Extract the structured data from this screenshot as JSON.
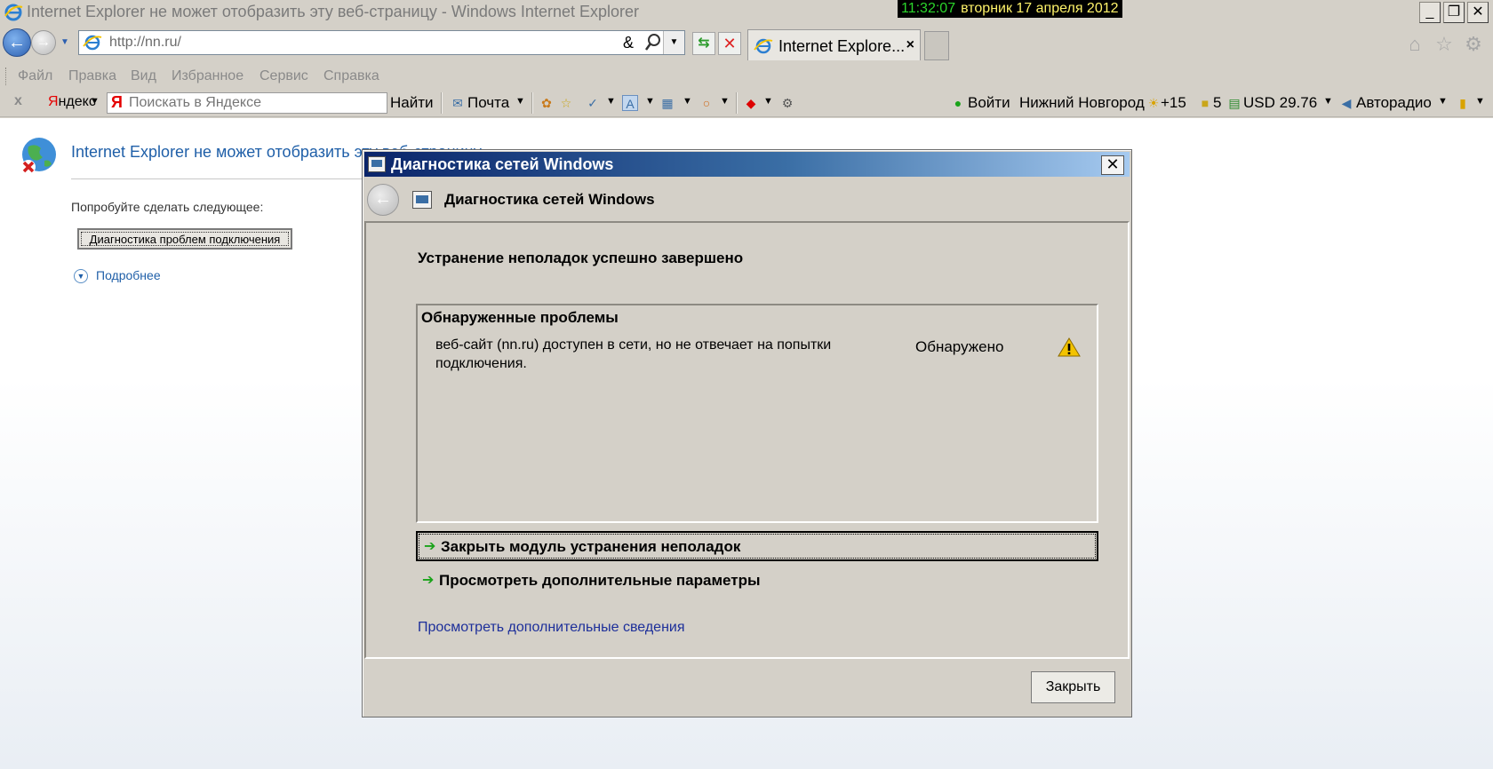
{
  "window": {
    "title": "Internet Explorer не может отобразить эту веб-страницу - Windows Internet Explorer",
    "clock_time": "11:32:07",
    "clock_date": "вторник 17 апреля 2012",
    "minimize": "_",
    "restore": "❐",
    "close": "✕"
  },
  "navigation": {
    "address_url": "http://nn.ru/",
    "address_amp": "&",
    "tab_label": "Internet Explore...",
    "tab_close": "×"
  },
  "menu": {
    "items": [
      "Файл",
      "Правка",
      "Вид",
      "Избранное",
      "Сервис",
      "Справка"
    ]
  },
  "yandex_bar": {
    "close": "x",
    "brand_first": "Я",
    "brand_rest": "ндекс",
    "search_placeholder": "Поискать в Яндексе",
    "find_button": "Найти",
    "mail": "Почта",
    "login": "Войти",
    "city": "Нижний Новгород",
    "temperature": "+15",
    "traffic": "5",
    "currency": "USD 29.76",
    "radio": "Авторадио"
  },
  "page": {
    "error_title": "Internet Explorer не может отобразить эту веб-страницу",
    "try_text": "Попробуйте сделать следующее:",
    "diagnose_button": "Диагностика проблем подключения",
    "more_link": "Подробнее"
  },
  "dialog": {
    "title": "Диагностика сетей Windows",
    "close": "✕",
    "header_title": "Диагностика сетей Windows",
    "status": "Устранение неполадок успешно завершено",
    "problems_heading": "Обнаруженные проблемы",
    "problem_description": "веб-сайт (nn.ru) доступен в сети, но не отвечает на попытки подключения.",
    "problem_status": "Обнаружено",
    "action_close_module": "Закрыть модуль устранения неполадок",
    "action_more_options": "Просмотреть дополнительные параметры",
    "more_info_link": "Просмотреть дополнительные сведения",
    "close_button": "Закрыть"
  },
  "colors": {
    "chrome_bg": "#d4d0c8",
    "link_blue": "#1f5fa8",
    "dialog_title_start": "#0a246a",
    "dialog_title_end": "#a6caf0",
    "clock_time": "#2bd52b",
    "clock_date": "#fff36a"
  }
}
